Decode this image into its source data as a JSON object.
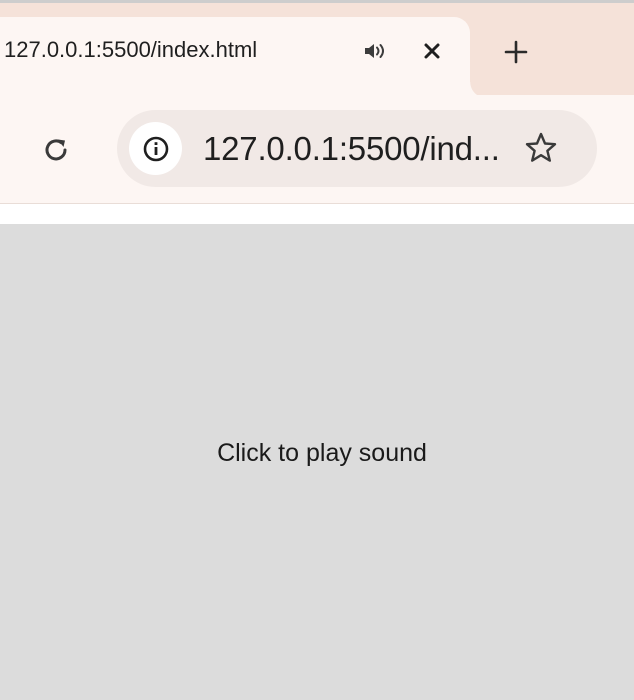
{
  "tab": {
    "title": "127.0.0.1:5500/index.html",
    "audio_icon": "speaker-playing-icon",
    "close_icon": "close-icon"
  },
  "new_tab_icon": "plus-icon",
  "toolbar": {
    "reload_icon": "reload-icon",
    "site_info_icon": "info-circle-icon",
    "url": "127.0.0.1:5500/ind...",
    "bookmark_icon": "star-outline-icon"
  },
  "page": {
    "message": "Click to play sound",
    "background_color": "#dcdcdc"
  },
  "colors": {
    "tabstrip": "#f5e2d9",
    "toolbar": "#fdf6f3",
    "omnibox": "#f1e9e6"
  }
}
